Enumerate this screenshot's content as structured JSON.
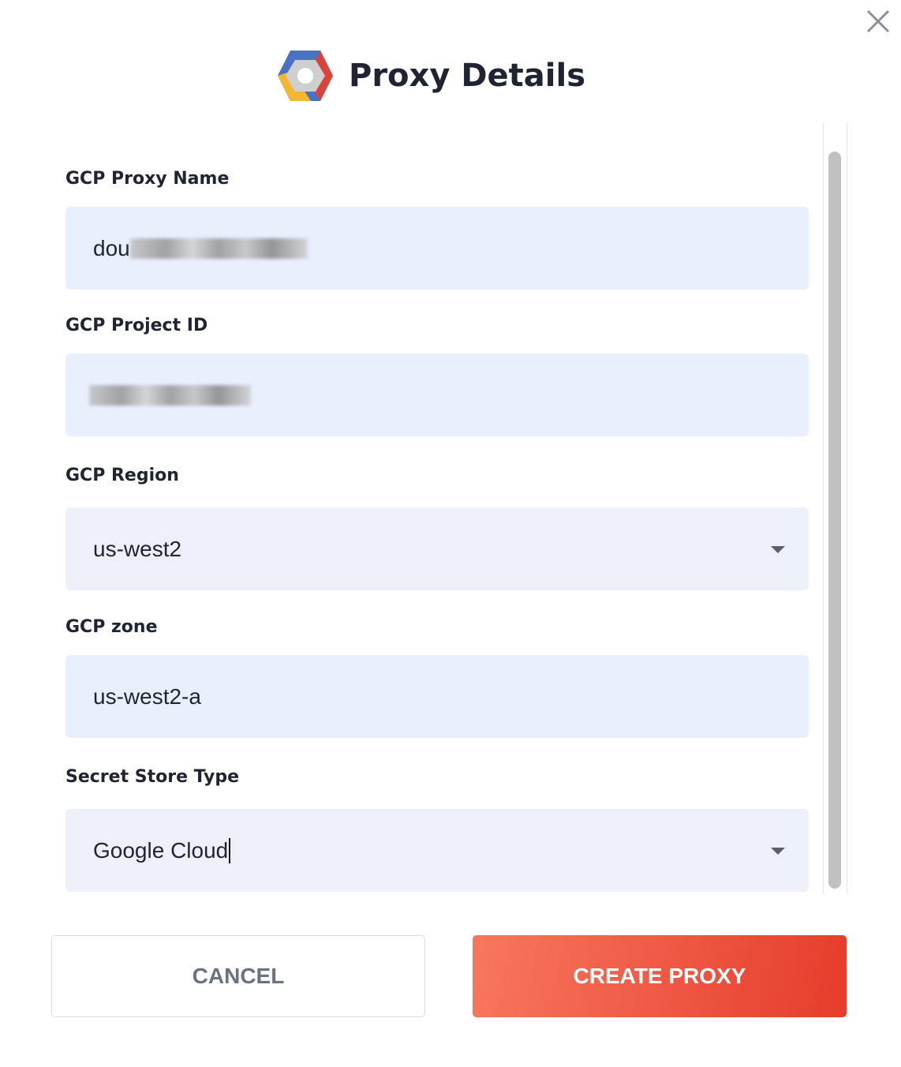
{
  "dialog": {
    "title": "Proxy Details",
    "logo": "google-cloud-logo",
    "close_icon": "close-icon"
  },
  "form": {
    "proxy_name": {
      "label": "GCP Proxy Name",
      "value": "dou"
    },
    "project_id": {
      "label": "GCP Project ID",
      "value": ""
    },
    "region": {
      "label": "GCP Region",
      "value": "us-west2"
    },
    "zone": {
      "label": "GCP zone",
      "value": "us-west2-a"
    },
    "secret_store": {
      "label": "Secret Store Type",
      "value": "Google Cloud"
    }
  },
  "buttons": {
    "cancel": "CANCEL",
    "create": "CREATE PROXY"
  },
  "colors": {
    "primary": "#ee5a45",
    "field_bg": "#e8f0fe",
    "select_bg": "#edf0f8"
  }
}
